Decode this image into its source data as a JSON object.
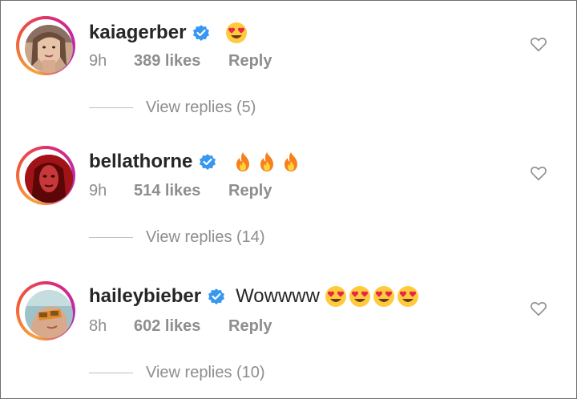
{
  "colors": {
    "username": "#262626",
    "meta": "#8e8e8e",
    "verified": "#3897f0",
    "ring_gradient": [
      "#f9a33a",
      "#f0583a",
      "#d92b7a",
      "#b52ab8"
    ]
  },
  "comments": [
    {
      "username": "kaiagerber",
      "verified": true,
      "text": "",
      "emojis": [
        "heart-eyes-emoji"
      ],
      "time": "9h",
      "likes": "389 likes",
      "reply_label": "Reply",
      "view_replies": "View replies (5)"
    },
    {
      "username": "bellathorne",
      "verified": true,
      "text": "",
      "emojis": [
        "fire-emoji",
        "fire-emoji",
        "fire-emoji"
      ],
      "time": "9h",
      "likes": "514 likes",
      "reply_label": "Reply",
      "view_replies": "View replies (14)"
    },
    {
      "username": "haileybieber",
      "verified": true,
      "text": "Wowwww",
      "emojis": [
        "heart-eyes-emoji",
        "heart-eyes-emoji",
        "heart-eyes-emoji",
        "heart-eyes-emoji"
      ],
      "time": "8h",
      "likes": "602 likes",
      "reply_label": "Reply",
      "view_replies": "View replies (10)"
    }
  ],
  "icons": {
    "like": "heart-outline-icon",
    "verified": "verified-badge-icon"
  }
}
